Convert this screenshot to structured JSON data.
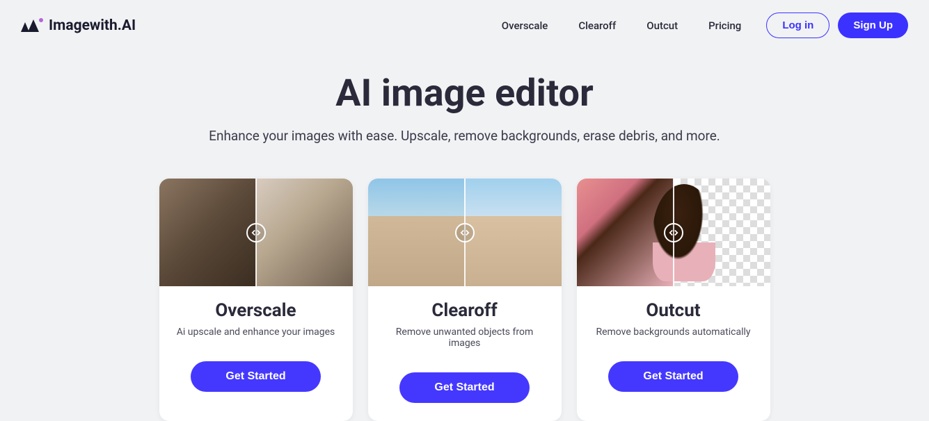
{
  "brand": {
    "name": "Imagewith.AI"
  },
  "nav": {
    "links": [
      "Overscale",
      "Clearoff",
      "Outcut",
      "Pricing"
    ],
    "login": "Log in",
    "signup": "Sign Up"
  },
  "hero": {
    "title": "AI image editor",
    "subtitle": "Enhance your images with ease. Upscale, remove backgrounds, erase debris, and more."
  },
  "cards": [
    {
      "title": "Overscale",
      "desc": "Ai upscale and enhance your images",
      "cta": "Get Started"
    },
    {
      "title": "Clearoff",
      "desc": "Remove unwanted objects from images",
      "cta": "Get Started"
    },
    {
      "title": "Outcut",
      "desc": "Remove backgrounds automatically",
      "cta": "Get Started"
    }
  ]
}
